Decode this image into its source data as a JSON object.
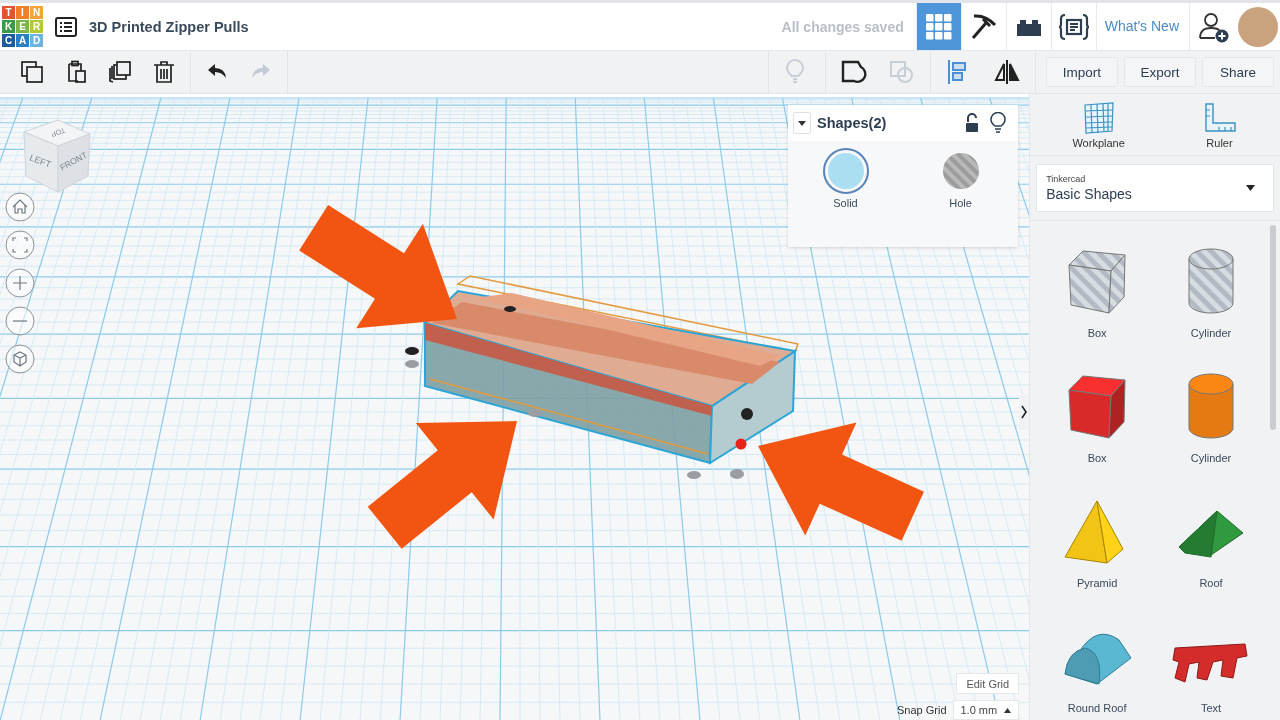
{
  "app": {
    "logo_letters": [
      {
        "char": "T",
        "color": "#e4532b"
      },
      {
        "char": "I",
        "color": "#ef7f2a"
      },
      {
        "char": "N",
        "color": "#f3a33a"
      },
      {
        "char": "K",
        "color": "#3a9a48"
      },
      {
        "char": "E",
        "color": "#7ab648"
      },
      {
        "char": "R",
        "color": "#b5c83c"
      },
      {
        "char": "C",
        "color": "#1d5a9c"
      },
      {
        "char": "A",
        "color": "#2b7fc4"
      },
      {
        "char": "D",
        "color": "#6fb3dd"
      }
    ],
    "design_title": "3D Printed Zipper Pulls",
    "save_status": "All changes saved",
    "views": [
      {
        "kind": "grid",
        "selected": true
      },
      {
        "kind": "pickaxe",
        "selected": false
      },
      {
        "kind": "brick",
        "selected": false
      },
      {
        "kind": "code",
        "selected": false
      }
    ],
    "whats_new": "What's New"
  },
  "toolbar": {
    "edit_tools": [
      {
        "kind": "copy",
        "disabled": false
      },
      {
        "kind": "paste",
        "disabled": false
      },
      {
        "kind": "duplicate",
        "disabled": false
      },
      {
        "kind": "delete",
        "disabled": false
      },
      {
        "kind": "undo",
        "disabled": false
      },
      {
        "kind": "redo",
        "disabled": true
      }
    ],
    "shape_tools": [
      {
        "kind": "bulb",
        "disabled": true
      },
      {
        "kind": "group",
        "disabled": false
      },
      {
        "kind": "ungroup",
        "disabled": true
      },
      {
        "kind": "align",
        "disabled": false
      },
      {
        "kind": "mirror",
        "disabled": false
      }
    ],
    "buttons": [
      "Import",
      "Export",
      "Share"
    ]
  },
  "view_cube": {
    "faces": [
      "TOP",
      "LEFT",
      "FRONT"
    ]
  },
  "nav_buttons": [
    {
      "kind": "home"
    },
    {
      "kind": "fit"
    },
    {
      "kind": "zoom-in"
    },
    {
      "kind": "zoom-out"
    },
    {
      "kind": "ortho"
    }
  ],
  "inspector": {
    "title": "Shapes(2)",
    "modes": [
      {
        "label": "Solid",
        "kind": "solid",
        "selected": true
      },
      {
        "label": "Hole",
        "kind": "hole",
        "selected": false
      }
    ]
  },
  "grid_controls": {
    "edit_button": "Edit Grid",
    "snap_label": "Snap Grid",
    "snap_value": "1.0 mm"
  },
  "sidebar": {
    "tools": [
      {
        "kind": "workplane",
        "label": "Workplane"
      },
      {
        "kind": "ruler",
        "label": "Ruler"
      }
    ],
    "library": {
      "caption": "Tinkercad",
      "value": "Basic Shapes"
    },
    "shapes": [
      {
        "kind": "box-hole",
        "label": "Box"
      },
      {
        "kind": "cylinder-hole",
        "label": "Cylinder"
      },
      {
        "kind": "box",
        "label": "Box",
        "color": "#d92a2a"
      },
      {
        "kind": "cylinder",
        "label": "Cylinder",
        "color": "#e57a12"
      },
      {
        "kind": "pyramid",
        "label": "Pyramid",
        "color": "#f2c416"
      },
      {
        "kind": "roof",
        "label": "Roof",
        "color": "#2f9a3e"
      },
      {
        "kind": "round-roof",
        "label": "Round Roof",
        "color": "#5ab8d3"
      },
      {
        "kind": "text",
        "label": "Text",
        "color": "#d42b2b"
      }
    ]
  }
}
